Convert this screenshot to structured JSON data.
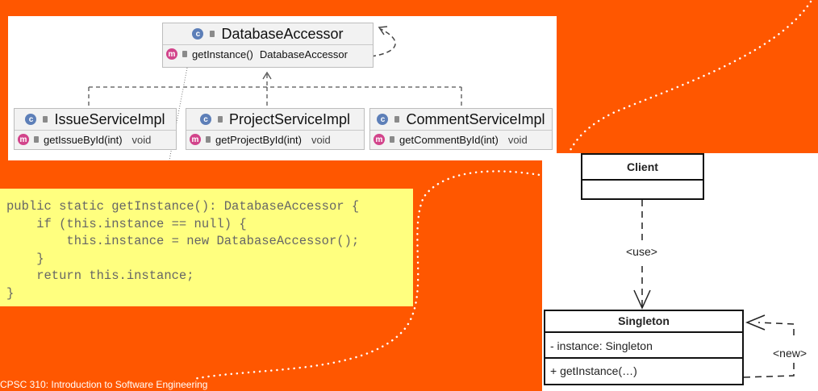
{
  "intellij_diagram": {
    "top_class": {
      "name": "DatabaseAccessor",
      "method": "getInstance()",
      "return_type": "DatabaseAccessor"
    },
    "impl_classes": [
      {
        "name": "IssueServiceImpl",
        "method": "getIssueById",
        "params": "(int)",
        "return_type": "void"
      },
      {
        "name": "ProjectServiceImpl",
        "method": "getProjectById",
        "params": "(int)",
        "return_type": "void"
      },
      {
        "name": "CommentServiceImpl",
        "method": "getCommentById",
        "params": "(int)",
        "return_type": "void"
      }
    ],
    "class_badge": "c",
    "method_badge": "m"
  },
  "code": {
    "lines": [
      "public static getInstance(): DatabaseAccessor {",
      "    if (this.instance == null) {",
      "        this.instance = new DatabaseAccessor();",
      "    }",
      "    return this.instance;",
      "}"
    ]
  },
  "uml": {
    "client": {
      "title": "Client"
    },
    "use_label": "<use>",
    "singleton": {
      "title": "Singleton",
      "attribute": "- instance: Singleton",
      "operation": "+ getInstance(…)"
    },
    "new_label": "<new>"
  },
  "footer": {
    "text": "CPSC 310: Introduction to Software Engineering"
  },
  "colors": {
    "background": "#FF5700",
    "code_bg": "#FFFF7F",
    "class_badge": "#5d7fb8",
    "method_badge": "#d2448b"
  }
}
